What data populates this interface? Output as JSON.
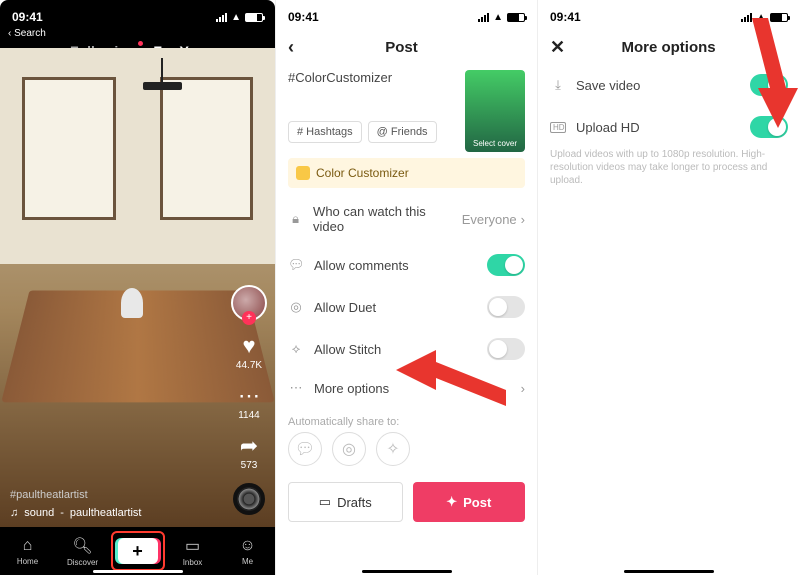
{
  "status": {
    "time": "09:41"
  },
  "feed": {
    "search_back": "Search",
    "tab_following": "Following",
    "tab_for_you": "For You",
    "likes": "44.7K",
    "comments": "1144",
    "shares": "573",
    "artist": "#paultheatlartist",
    "sound_prefix": "sound",
    "sound": "paultheatlartist"
  },
  "tabbar": {
    "home": "Home",
    "discover": "Discover",
    "inbox": "Inbox",
    "me": "Me"
  },
  "post": {
    "title": "Post",
    "caption": "#ColorCustomizer",
    "select_cover": "Select cover",
    "chip_hashtags": "# Hashtags",
    "chip_friends": "@ Friends",
    "banner": "Color Customizer",
    "privacy": "Who can watch this video",
    "privacy_value": "Everyone",
    "allow_comments": "Allow comments",
    "allow_duet": "Allow Duet",
    "allow_stitch": "Allow Stitch",
    "more_options": "More options",
    "auto_share": "Automatically share to:",
    "drafts": "Drafts",
    "post_btn": "Post"
  },
  "more": {
    "title": "More options",
    "save_video": "Save video",
    "upload_hd": "Upload HD",
    "hd_desc": "Upload videos with up to 1080p resolution. High-resolution videos may take longer to process and upload."
  }
}
